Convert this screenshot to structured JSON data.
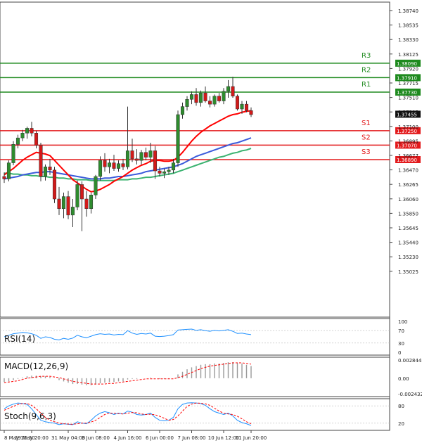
{
  "chart_data": {
    "type": "candlestick",
    "main": {
      "y_ticks": [
        "1.38740",
        "1.38535",
        "1.38330",
        "1.38125",
        "1.37920",
        "1.37715",
        "1.37510",
        "1.37305",
        "1.37100",
        "1.36895",
        "1.36677",
        "1.36470",
        "1.36265",
        "1.36060",
        "1.35850",
        "1.35645",
        "1.35440",
        "1.35230",
        "1.35025"
      ],
      "ylim": [
        1.3493,
        1.3885
      ],
      "current_price": "1.37455",
      "levels": [
        {
          "name": "R3",
          "value": 1.3809,
          "label": "1.38090",
          "color": "#1e8a1e"
        },
        {
          "name": "R2",
          "value": 1.3791,
          "label": "1.37910",
          "color": "#1e8a1e"
        },
        {
          "name": "R1",
          "value": 1.3773,
          "label": "1.37730",
          "color": "#1e8a1e"
        },
        {
          "name": "S1",
          "value": 1.3725,
          "label": "1.37250",
          "color": "#e31a1c"
        },
        {
          "name": "S2",
          "value": 1.3707,
          "label": "1.37070",
          "color": "#e31a1c"
        },
        {
          "name": "S3",
          "value": 1.3689,
          "label": "1.36890",
          "color": "#e31a1c"
        }
      ],
      "candles": [
        [
          1.3668,
          1.3673,
          1.366,
          1.3665
        ],
        [
          1.3665,
          1.3688,
          1.3662,
          1.3685
        ],
        [
          1.3685,
          1.3712,
          1.3682,
          1.3708
        ],
        [
          1.3708,
          1.372,
          1.3703,
          1.3716
        ],
        [
          1.3716,
          1.3726,
          1.3712,
          1.3722
        ],
        [
          1.3722,
          1.373,
          1.3715,
          1.3728
        ],
        [
          1.3728,
          1.3736,
          1.3718,
          1.3722
        ],
        [
          1.3722,
          1.3725,
          1.3703,
          1.3707
        ],
        [
          1.3707,
          1.371,
          1.3662,
          1.3668
        ],
        [
          1.3668,
          1.3683,
          1.3663,
          1.368
        ],
        [
          1.368,
          1.369,
          1.367,
          1.3676
        ],
        [
          1.3676,
          1.368,
          1.3635,
          1.364
        ],
        [
          1.364,
          1.3655,
          1.362,
          1.3628
        ],
        [
          1.3628,
          1.3648,
          1.3616,
          1.3643
        ],
        [
          1.3643,
          1.365,
          1.3615,
          1.362
        ],
        [
          1.362,
          1.364,
          1.3605,
          1.363
        ],
        [
          1.363,
          1.3663,
          1.3626,
          1.3658
        ],
        [
          1.3658,
          1.3662,
          1.36,
          1.364
        ],
        [
          1.364,
          1.365,
          1.3618,
          1.3628
        ],
        [
          1.3628,
          1.3648,
          1.3622,
          1.3645
        ],
        [
          1.3645,
          1.367,
          1.364,
          1.3668
        ],
        [
          1.3668,
          1.3693,
          1.3663,
          1.3688
        ],
        [
          1.3688,
          1.3697,
          1.3674,
          1.368
        ],
        [
          1.368,
          1.369,
          1.3672,
          1.3685
        ],
        [
          1.3685,
          1.3695,
          1.3675,
          1.3678
        ],
        [
          1.3678,
          1.3688,
          1.3674,
          1.3684
        ],
        [
          1.3684,
          1.369,
          1.3676,
          1.368
        ],
        [
          1.368,
          1.3755,
          1.3677,
          1.37
        ],
        [
          1.37,
          1.3715,
          1.3686,
          1.369
        ],
        [
          1.369,
          1.3702,
          1.3683,
          1.3688
        ],
        [
          1.3688,
          1.3701,
          1.3683,
          1.3698
        ],
        [
          1.3698,
          1.3704,
          1.3688,
          1.3692
        ],
        [
          1.3692,
          1.371,
          1.3685,
          1.37
        ],
        [
          1.37,
          1.3706,
          1.3665,
          1.3675
        ],
        [
          1.3675,
          1.368,
          1.3668,
          1.3672
        ],
        [
          1.3672,
          1.3678,
          1.3666,
          1.3674
        ],
        [
          1.3674,
          1.368,
          1.367,
          1.3676
        ],
        [
          1.3676,
          1.369,
          1.3672,
          1.3685
        ],
        [
          1.3685,
          1.375,
          1.368,
          1.3745
        ],
        [
          1.3745,
          1.376,
          1.374,
          1.3755
        ],
        [
          1.3755,
          1.3768,
          1.375,
          1.3764
        ],
        [
          1.3764,
          1.3774,
          1.3758,
          1.377
        ],
        [
          1.377,
          1.3778,
          1.3756,
          1.376
        ],
        [
          1.376,
          1.3775,
          1.3755,
          1.3772
        ],
        [
          1.3772,
          1.378,
          1.376,
          1.3762
        ],
        [
          1.3762,
          1.3768,
          1.3754,
          1.3758
        ],
        [
          1.3758,
          1.377,
          1.3755,
          1.3768
        ],
        [
          1.3768,
          1.3772,
          1.376,
          1.3762
        ],
        [
          1.3762,
          1.3778,
          1.3758,
          1.3774
        ],
        [
          1.3774,
          1.3788,
          1.3766,
          1.378
        ],
        [
          1.378,
          1.3792,
          1.3766,
          1.3768
        ],
        [
          1.3768,
          1.377,
          1.375,
          1.3752
        ],
        [
          1.3752,
          1.3762,
          1.3746,
          1.3758
        ],
        [
          1.3758,
          1.3762,
          1.3748,
          1.375
        ],
        [
          1.375,
          1.3754,
          1.3742,
          1.3745
        ]
      ],
      "ma_fast": [
        1.367,
        1.3674,
        1.3678,
        1.3683,
        1.3688,
        1.3692,
        1.3695,
        1.3698,
        1.3697,
        1.3696,
        1.3694,
        1.3688,
        1.3682,
        1.3676,
        1.367,
        1.3664,
        1.366,
        1.3656,
        1.3652,
        1.3649,
        1.365,
        1.3652,
        1.3655,
        1.3658,
        1.3662,
        1.3665,
        1.3668,
        1.3672,
        1.3676,
        1.3679,
        1.3682,
        1.3684,
        1.3687,
        1.3688,
        1.3688,
        1.3687,
        1.3687,
        1.3688,
        1.3692,
        1.3698,
        1.3705,
        1.3712,
        1.3718,
        1.3723,
        1.3727,
        1.3731,
        1.3734,
        1.3737,
        1.374,
        1.3743,
        1.3745,
        1.3746,
        1.3748,
        1.3749,
        1.375
      ],
      "ma_mid": [
        1.3665,
        1.3666,
        1.3667,
        1.3668,
        1.367,
        1.3671,
        1.3672,
        1.3673,
        1.3673,
        1.3674,
        1.3674,
        1.3673,
        1.3672,
        1.3671,
        1.367,
        1.3669,
        1.3668,
        1.3667,
        1.3666,
        1.3665,
        1.3665,
        1.3665,
        1.3666,
        1.3666,
        1.3667,
        1.3668,
        1.3668,
        1.3669,
        1.367,
        1.3671,
        1.3672,
        1.3674,
        1.3675,
        1.3676,
        1.3677,
        1.3678,
        1.3679,
        1.368,
        1.3682,
        1.3684,
        1.3687,
        1.369,
        1.3693,
        1.3695,
        1.3697,
        1.3699,
        1.3701,
        1.3703,
        1.3705,
        1.3707,
        1.3709,
        1.371,
        1.3712,
        1.3714,
        1.3716
      ],
      "ma_slow": [
        1.3672,
        1.3672,
        1.3671,
        1.3671,
        1.367,
        1.367,
        1.3669,
        1.3669,
        1.3668,
        1.3668,
        1.3667,
        1.3667,
        1.3666,
        1.3666,
        1.3665,
        1.3665,
        1.3664,
        1.3664,
        1.3664,
        1.3663,
        1.3663,
        1.3663,
        1.3663,
        1.3663,
        1.3663,
        1.3664,
        1.3664,
        1.3664,
        1.3665,
        1.3665,
        1.3666,
        1.3667,
        1.3667,
        1.3668,
        1.3669,
        1.367,
        1.3671,
        1.3672,
        1.3674,
        1.3676,
        1.3678,
        1.368,
        1.3682,
        1.3684,
        1.3686,
        1.3688,
        1.369,
        1.3692,
        1.3693,
        1.3695,
        1.3697,
        1.3698,
        1.37,
        1.3701,
        1.3703
      ],
      "ma_colors": {
        "fast": "#ff0000",
        "mid": "#3b5bdb",
        "slow": "#3cb371"
      }
    },
    "rsi": {
      "label": "RSI(14)",
      "ticks": [
        "100",
        "70",
        "30",
        "0"
      ],
      "levels": [
        70,
        30
      ],
      "color": "#1e90ff",
      "values": [
        50,
        55,
        60,
        62,
        64,
        63,
        60,
        55,
        45,
        50,
        48,
        42,
        40,
        45,
        42,
        46,
        55,
        50,
        47,
        52,
        57,
        60,
        58,
        59,
        56,
        58,
        57,
        70,
        62,
        58,
        61,
        59,
        62,
        52,
        51,
        52,
        54,
        57,
        72,
        73,
        74,
        75,
        71,
        73,
        70,
        68,
        71,
        69,
        71,
        73,
        68,
        61,
        62,
        59,
        57
      ]
    },
    "macd": {
      "label": "MACD(12,26,9)",
      "ticks": [
        "0.002844",
        "0.00",
        "-0.002432"
      ],
      "range": [
        -0.002432,
        0.002844
      ],
      "signal_color": "#ff0000",
      "hist": [
        -0.0006,
        -0.0005,
        -0.0003,
        -0.0001,
        0.0001,
        0.0003,
        0.0004,
        0.0004,
        0.0003,
        0.0003,
        0.0002,
        0.0,
        -0.0003,
        -0.0005,
        -0.0007,
        -0.0009,
        -0.0009,
        -0.001,
        -0.0011,
        -0.0011,
        -0.001,
        -0.0008,
        -0.0007,
        -0.0006,
        -0.0006,
        -0.0005,
        -0.0005,
        -0.0002,
        -0.0001,
        -0.0001,
        0.0,
        0.0,
        0.0001,
        0.0,
        -0.0001,
        -0.0001,
        -0.0001,
        0.0,
        0.0006,
        0.001,
        0.0014,
        0.0017,
        0.0019,
        0.0021,
        0.0022,
        0.0022,
        0.0023,
        0.0023,
        0.0024,
        0.0025,
        0.0025,
        0.0024,
        0.0023,
        0.0021,
        0.0019
      ],
      "signal": [
        -0.0007,
        -0.0006,
        -0.0005,
        -0.0004,
        -0.0002,
        0.0,
        0.0001,
        0.0002,
        0.0003,
        0.0003,
        0.0003,
        0.0002,
        0.0001,
        -0.0001,
        -0.0003,
        -0.0005,
        -0.0006,
        -0.0007,
        -0.0008,
        -0.0009,
        -0.0009,
        -0.0009,
        -0.0009,
        -0.0008,
        -0.0008,
        -0.0007,
        -0.0006,
        -0.0005,
        -0.0004,
        -0.0003,
        -0.0002,
        -0.0001,
        -0.0001,
        -0.0001,
        -0.0001,
        -0.0001,
        -0.0001,
        -0.0001,
        0.0001,
        0.0003,
        0.0006,
        0.0009,
        0.0012,
        0.0015,
        0.0017,
        0.0019,
        0.002,
        0.0021,
        0.0022,
        0.0023,
        0.0024,
        0.0024,
        0.0024,
        0.0023,
        0.0022
      ]
    },
    "stoch": {
      "label": "Stoch(9,6,3)",
      "ticks": [
        "80",
        "20"
      ],
      "main_color": "#1e90ff",
      "signal_color": "#ff0000",
      "k": [
        70,
        80,
        86,
        90,
        88,
        85,
        70,
        50,
        30,
        25,
        22,
        20,
        15,
        18,
        16,
        15,
        25,
        20,
        18,
        30,
        45,
        55,
        60,
        56,
        50,
        55,
        52,
        62,
        58,
        50,
        48,
        50,
        55,
        40,
        30,
        28,
        30,
        40,
        70,
        85,
        90,
        91,
        90,
        88,
        82,
        70,
        60,
        55,
        50,
        55,
        45,
        30,
        22,
        18,
        12
      ],
      "d": [
        65,
        72,
        78,
        85,
        88,
        88,
        82,
        70,
        55,
        40,
        30,
        25,
        20,
        18,
        17,
        16,
        18,
        20,
        20,
        24,
        30,
        40,
        50,
        55,
        55,
        53,
        52,
        55,
        57,
        56,
        52,
        50,
        51,
        49,
        44,
        37,
        30,
        33,
        45,
        62,
        78,
        86,
        90,
        89,
        87,
        82,
        72,
        62,
        55,
        52,
        50,
        44,
        35,
        25,
        18
      ]
    },
    "x_ticks": [
      {
        "i": 0,
        "label": "8 May 12:00"
      },
      {
        "i": 6,
        "label": "29 May 20:00"
      },
      {
        "i": 14,
        "label": "31 May 04:00"
      },
      {
        "i": 20,
        "label": "3 Jun 08:00"
      },
      {
        "i": 27,
        "label": "4 Jun 16:00"
      },
      {
        "i": 34,
        "label": "6 Jun 00:00"
      },
      {
        "i": 41,
        "label": "7 Jun 08:00"
      },
      {
        "i": 48,
        "label": "10 Jun 12:00"
      },
      {
        "i": 54,
        "label": "11 Jun 20:00"
      }
    ]
  }
}
